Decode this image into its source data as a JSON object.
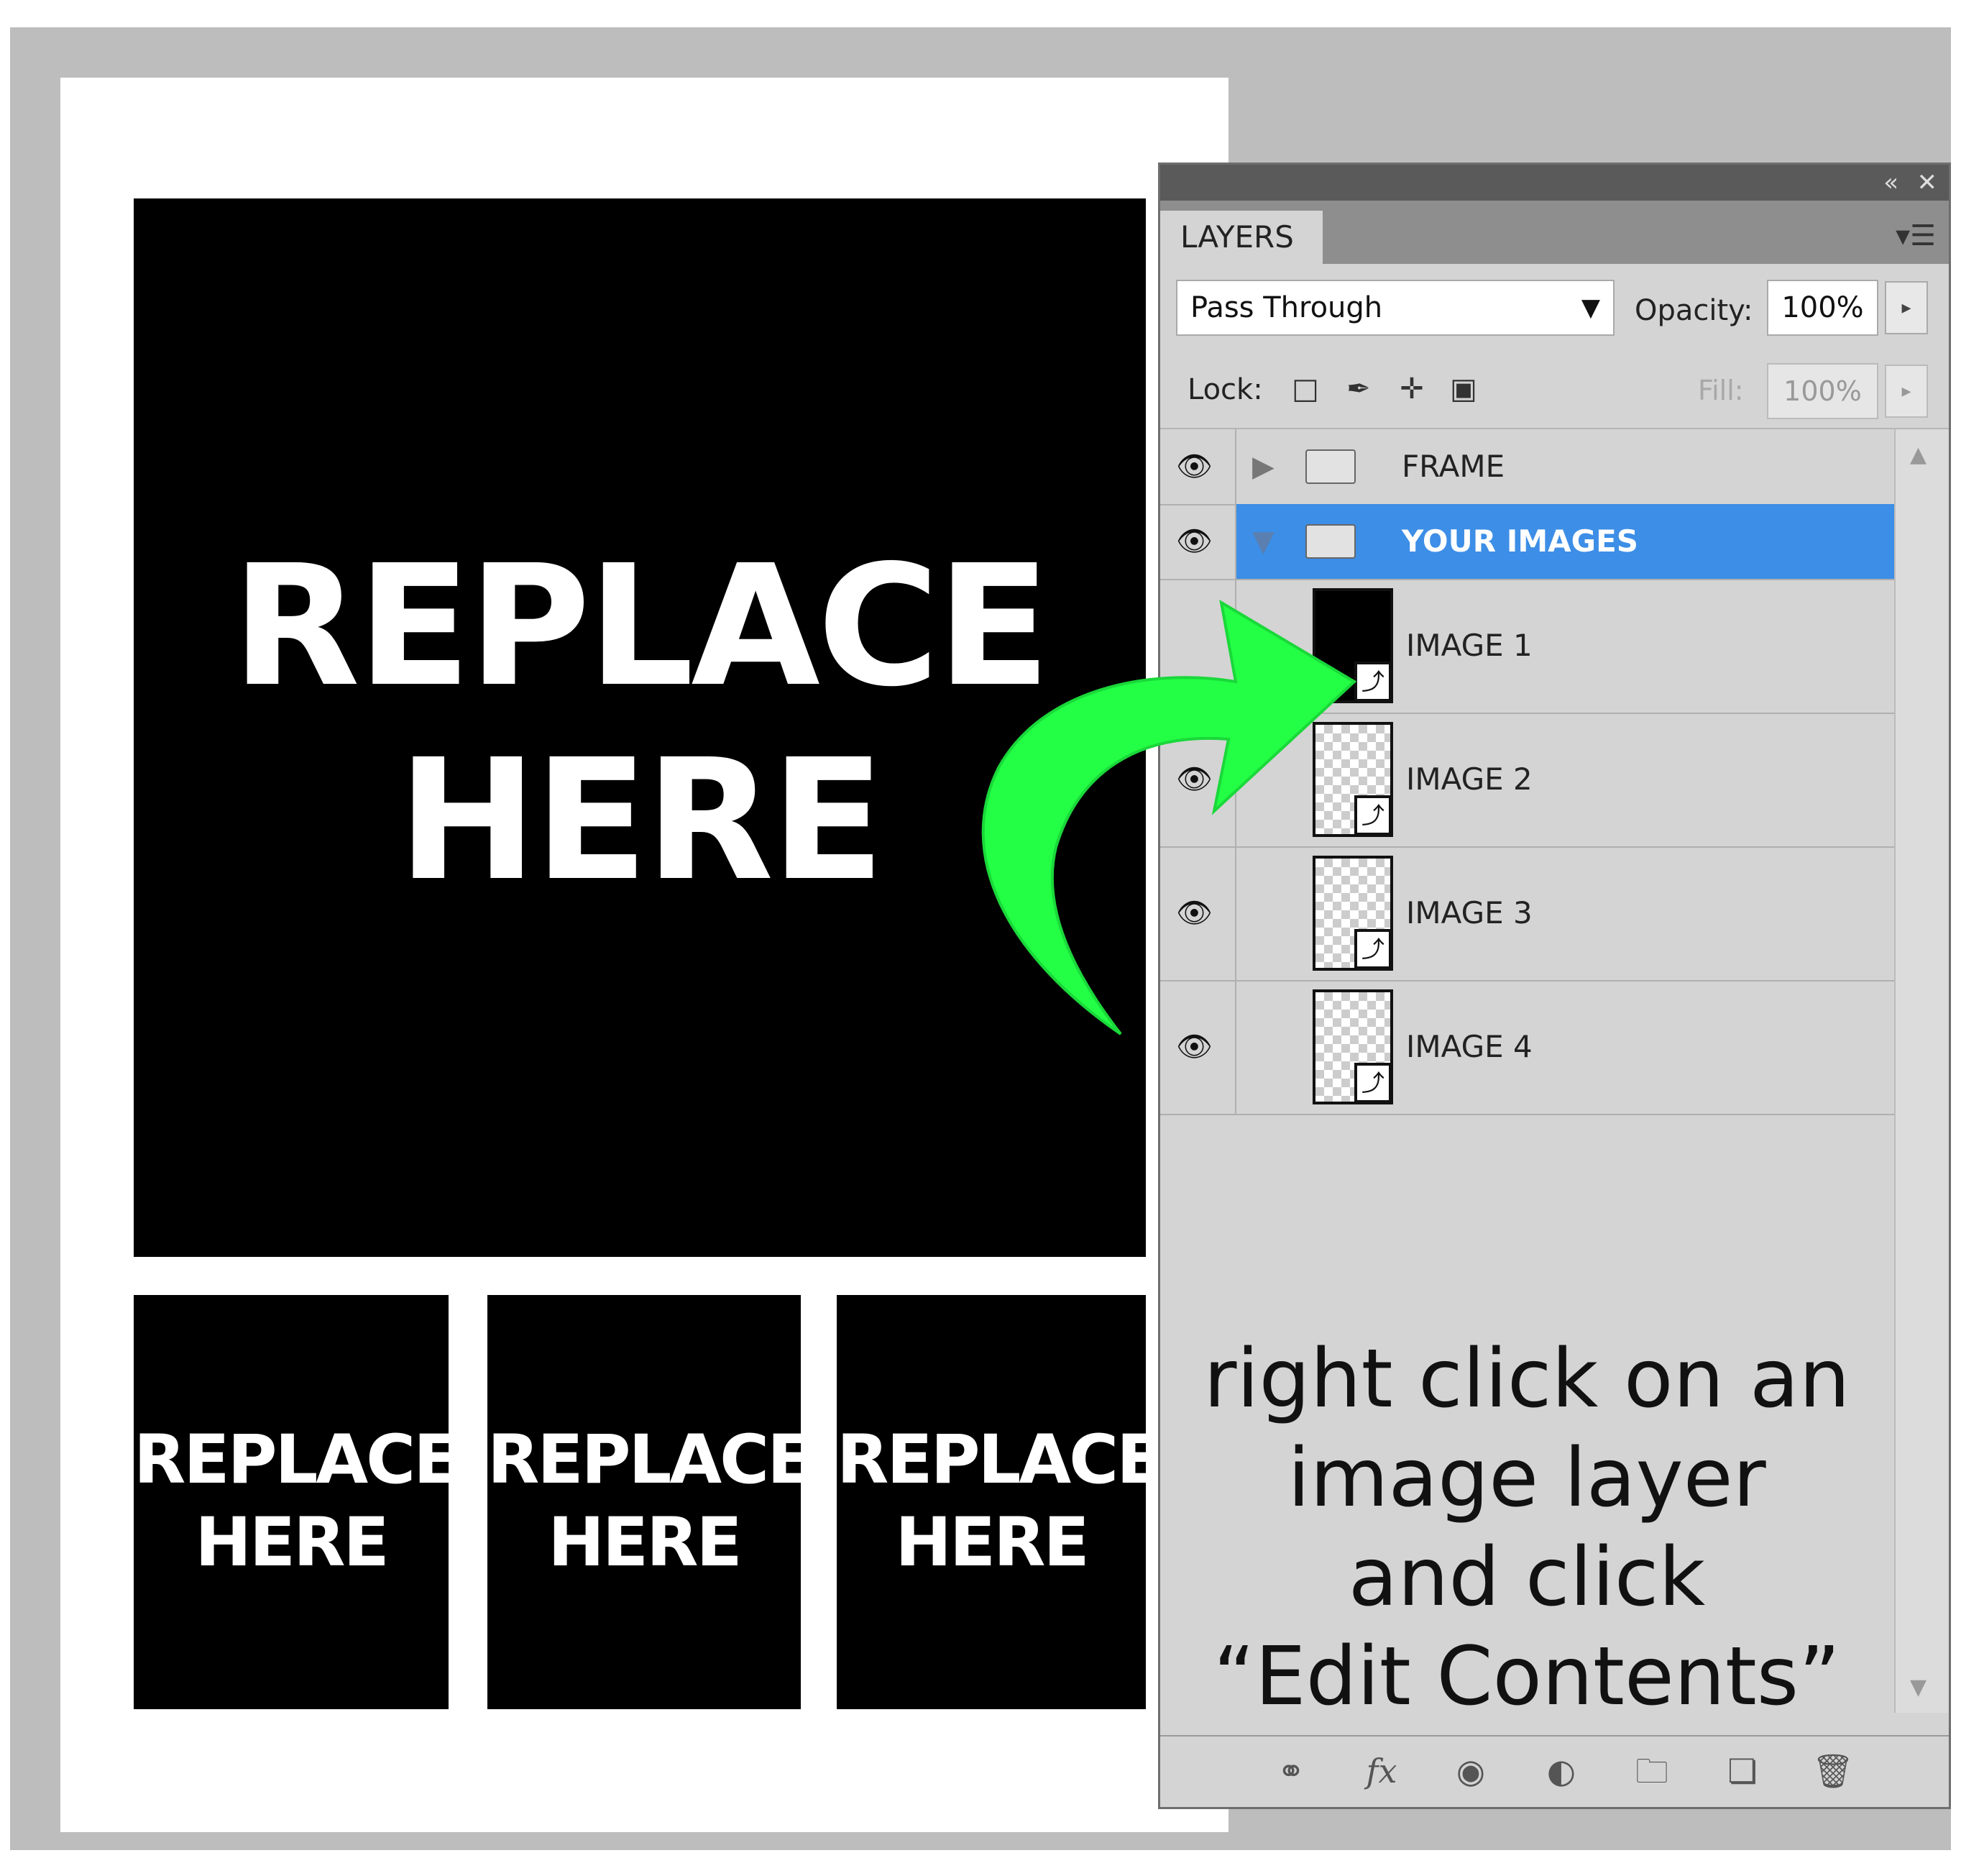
{
  "canvas": {
    "big_placeholder": {
      "line1": "REPLACE",
      "line2": "HERE"
    },
    "small_placeholders": [
      {
        "line1": "REPLACE",
        "line2": "HERE"
      },
      {
        "line1": "REPLACE",
        "line2": "HERE"
      },
      {
        "line1": "REPLACE",
        "line2": "HERE"
      }
    ]
  },
  "panel": {
    "collapse_icon": "double-chevron-left-icon",
    "close_icon": "close-icon",
    "tab_label": "LAYERS",
    "blend_mode": "Pass Through",
    "opacity_label": "Opacity:",
    "opacity_value": "100%",
    "lock_label": "Lock:",
    "fill_label": "Fill:",
    "fill_value": "100%",
    "layers": [
      {
        "name": "FRAME",
        "type": "group",
        "visible": true,
        "selected": false
      },
      {
        "name": "YOUR IMAGES",
        "type": "group",
        "visible": true,
        "selected": true
      },
      {
        "name": "IMAGE 1",
        "type": "smart-object",
        "visible": false,
        "selected": false
      },
      {
        "name": "IMAGE 2",
        "type": "smart-object",
        "visible": true,
        "selected": false
      },
      {
        "name": "IMAGE 3",
        "type": "smart-object",
        "visible": true,
        "selected": false
      },
      {
        "name": "IMAGE 4",
        "type": "smart-object",
        "visible": true,
        "selected": false
      }
    ],
    "instruction": {
      "line1": "right click on an",
      "line2": "image layer",
      "line3": "and click",
      "line4": "“Edit Contents”"
    }
  },
  "colors": {
    "selection": "#3d8ee6",
    "arrow": "#22ff44",
    "panel_bg": "#d4d4d4",
    "backdrop": "#bdbdbd"
  }
}
